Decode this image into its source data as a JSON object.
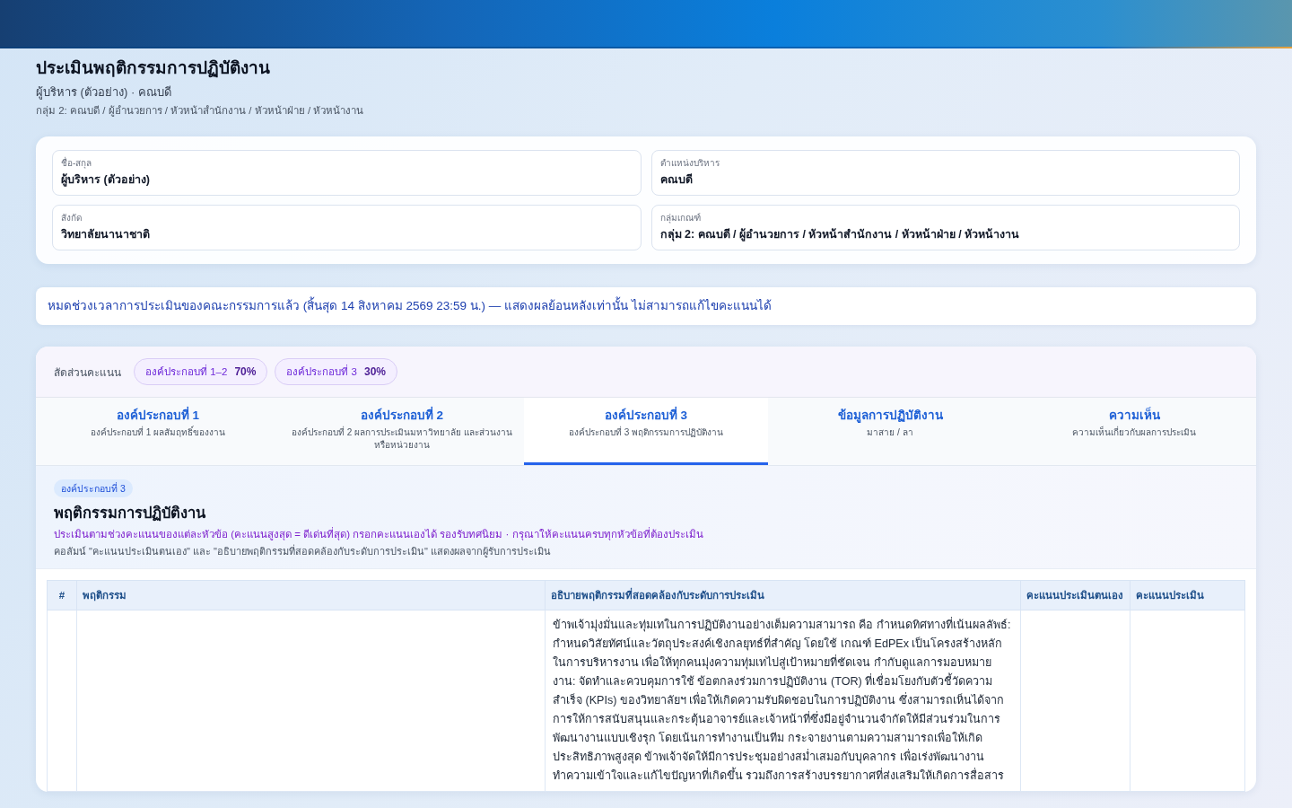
{
  "page": {
    "title": "ประเมินพฤติกรรมการปฏิบัติงาน",
    "subtitle": "ผู้บริหาร (ตัวอย่าง) · คณบดี",
    "breadcrumb": "กลุ่ม 2: คณบดี / ผู้อำนวยการ / หัวหน้าสำนักงาน / หัวหน้าฝ่าย / หัวหน้างาน"
  },
  "profile": {
    "fields": [
      {
        "label": "ชื่อ-สกุล",
        "value": "ผู้บริหาร (ตัวอย่าง)"
      },
      {
        "label": "ตำแหน่งบริหาร",
        "value": "คณบดี"
      },
      {
        "label": "สังกัด",
        "value": "วิทยาลัยนานาชาติ"
      },
      {
        "label": "กลุ่มเกณฑ์",
        "value": "กลุ่ม 2: คณบดี / ผู้อำนวยการ / หัวหน้าสำนักงาน / หัวหน้าฝ่าย / หัวหน้างาน"
      }
    ]
  },
  "notice": {
    "text": "หมดช่วงเวลาการประเมินของคณะกรรมการแล้ว (สิ้นสุด 14 สิงหาคม 2569 23:59 น.) — แสดงผลย้อนหลังเท่านั้น ไม่สามารถแก้ไขคะแนนได้"
  },
  "score_ratio": {
    "label": "สัดส่วนคะแนน",
    "items": [
      {
        "label": "องค์ประกอบที่ 1–2",
        "value": "70%"
      },
      {
        "label": "องค์ประกอบที่ 3",
        "value": "30%"
      }
    ]
  },
  "tabs": [
    {
      "title": "องค์ประกอบที่ 1",
      "subtitle": "องค์ประกอบที่ 1 ผลสัมฤทธิ์ของงาน",
      "selected": false
    },
    {
      "title": "องค์ประกอบที่ 2",
      "subtitle": "องค์ประกอบที่ 2 ผลการประเมินมหาวิทยาลัย และส่วนงานหรือหน่วยงาน",
      "selected": false
    },
    {
      "title": "องค์ประกอบที่ 3",
      "subtitle": "องค์ประกอบที่ 3 พฤติกรรมการปฏิบัติงาน",
      "selected": true
    },
    {
      "title": "ข้อมูลการปฏิบัติงาน",
      "subtitle": "มาสาย / ลา",
      "selected": false
    },
    {
      "title": "ความเห็น",
      "subtitle": "ความเห็นเกี่ยวกับผลการประเมิน",
      "selected": false
    }
  ],
  "section": {
    "badge": "องค์ประกอบที่ 3",
    "title": "พฤติกรรมการปฏิบัติงาน",
    "instruction": "ประเมินตามช่วงคะแนนของแต่ละหัวข้อ (คะแนนสูงสุด = ดีเด่นที่สุด) กรอกคะแนนเองได้ รองรับทศนิยม · กรุณาให้คะแนนครบทุกหัวข้อที่ต้องประเมิน",
    "note": "คอลัมน์ \"คะแนนประเมินตนเอง\" และ \"อธิบายพฤติกรรมที่สอดคล้องกับระดับการประเมิน\" แสดงผลจากผู้รับการประเมิน"
  },
  "table": {
    "columns": [
      "#",
      "พฤติกรรม",
      "อธิบายพฤติกรรมที่สอดคล้องกับระดับการประเมิน",
      "คะแนนประเมินตนเอง",
      "คะแนนประเมิน"
    ],
    "rows": [
      {
        "description": "ข้าพเจ้ามุ่งมั่นและทุ่มเทในการปฏิบัติงานอย่างเต็มความสามารถ คือ กำหนดทิศทางที่เน้นผลลัพธ์: กำหนดวิสัยทัศน์และวัตถุประสงค์เชิงกลยุทธ์ที่สำคัญ โดยใช้ เกณฑ์ EdPEx เป็นโครงสร้างหลักในการบริหารงาน เพื่อให้ทุกคนมุ่งความทุ่มเทไปสู่เป้าหมายที่ชัดเจน กำกับดูแลการมอบหมายงาน: จัดทำและควบคุมการใช้ ข้อตกลงร่วมการปฏิบัติงาน (TOR) ที่เชื่อมโยงกับตัวชี้วัดความสำเร็จ (KPIs) ของวิทยาลัยฯ เพื่อให้เกิดความรับผิดชอบในการปฏิบัติงาน ซึ่งสามารถเห็นได้จากการให้การสนับสนุนและกระตุ้นอาจารย์และเจ้าหน้าที่ซึ่งมีอยู่จำนวนจำกัดให้มีส่วนร่วมในการพัฒนางานแบบเชิงรุก โดยเน้นการทำงานเป็นทีม กระจายงานตามความสามารถเพื่อให้เกิดประสิทธิภาพสูงสุด ข้าพเจ้าจัดให้มีการประชุมอย่างสม่ำเสมอกับบุคลากร เพื่อเร่งพัฒนางานทำความเข้าใจและแก้ไขปัญหาที่เกิดขึ้น รวมถึงการสร้างบรรยากาศที่ส่งเสริมให้เกิดการสื่อสาร"
      }
    ]
  }
}
